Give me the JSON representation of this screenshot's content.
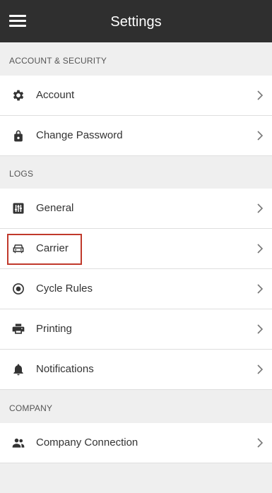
{
  "header": {
    "title": "Settings"
  },
  "sections": {
    "account_security": "ACCOUNT & SECURITY",
    "logs": "LOGS",
    "company": "COMPANY"
  },
  "items": {
    "account": {
      "label": "Account",
      "icon": "gear-icon"
    },
    "change_password": {
      "label": "Change Password",
      "icon": "lock-icon"
    },
    "general": {
      "label": "General",
      "icon": "sliders-icon"
    },
    "carrier": {
      "label": "Carrier",
      "icon": "truck-icon"
    },
    "cycle_rules": {
      "label": "Cycle Rules",
      "icon": "radio-target-icon"
    },
    "printing": {
      "label": "Printing",
      "icon": "printer-icon"
    },
    "notifications": {
      "label": "Notifications",
      "icon": "bell-icon"
    },
    "company_connection": {
      "label": "Company Connection",
      "icon": "people-icon"
    }
  },
  "colors": {
    "header_bg": "#2f2f2f",
    "page_bg": "#efefef",
    "highlight": "#c0392b"
  }
}
